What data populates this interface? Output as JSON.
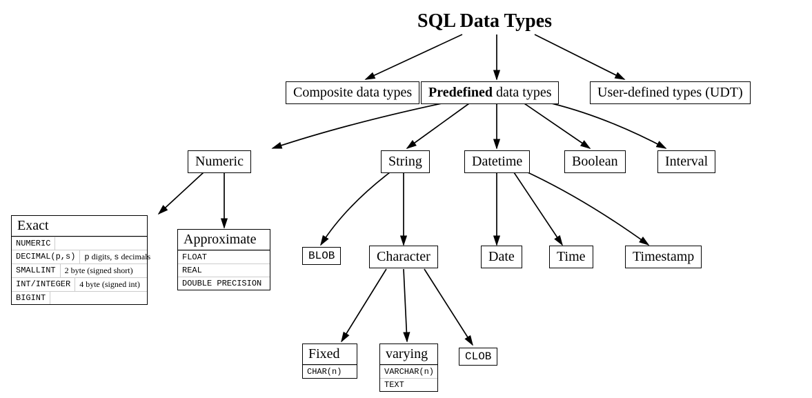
{
  "title": "SQL Data Types",
  "level1": {
    "composite": "Composite data types",
    "predefined_bold": "Predefined",
    "predefined_rest": " data types",
    "udt": "User-defined types (UDT)"
  },
  "predefined_children": {
    "numeric": "Numeric",
    "string": "String",
    "datetime": "Datetime",
    "boolean": "Boolean",
    "interval": "Interval"
  },
  "numeric": {
    "exact": {
      "header": "Exact",
      "rows": [
        {
          "type": "NUMERIC",
          "desc": ""
        },
        {
          "type": "DECIMAL(p,s)",
          "desc": "p digits, s decimals"
        },
        {
          "type": "SMALLINT",
          "desc": "2 byte (signed short)"
        },
        {
          "type": "INT/INTEGER",
          "desc": "4 byte (signed int)"
        },
        {
          "type": "BIGINT",
          "desc": ""
        }
      ]
    },
    "approximate": {
      "header": "Approximate",
      "rows": [
        {
          "type": "FLOAT"
        },
        {
          "type": "REAL"
        },
        {
          "type": "DOUBLE PRECISION"
        }
      ]
    }
  },
  "string": {
    "blob": "BLOB",
    "character": "Character",
    "fixed": {
      "header": "Fixed",
      "rows": [
        {
          "type": "CHAR(n)"
        }
      ]
    },
    "varying": {
      "header": "varying",
      "rows": [
        {
          "type": "VARCHAR(n)"
        },
        {
          "type": "TEXT"
        }
      ]
    },
    "clob": "CLOB"
  },
  "datetime": {
    "date": "Date",
    "time": "Time",
    "timestamp": "Timestamp"
  },
  "chart_data": {
    "type": "tree",
    "root": "SQL Data Types",
    "children": [
      {
        "name": "Composite data types"
      },
      {
        "name": "Predefined data types",
        "children": [
          {
            "name": "Numeric",
            "children": [
              {
                "name": "Exact",
                "types": [
                  "NUMERIC",
                  "DECIMAL(p,s)",
                  "SMALLINT",
                  "INT/INTEGER",
                  "BIGINT"
                ],
                "notes": {
                  "DECIMAL(p,s)": "p digits, s decimals",
                  "SMALLINT": "2 byte (signed short)",
                  "INT/INTEGER": "4 byte (signed int)"
                }
              },
              {
                "name": "Approximate",
                "types": [
                  "FLOAT",
                  "REAL",
                  "DOUBLE PRECISION"
                ]
              }
            ]
          },
          {
            "name": "String",
            "children": [
              {
                "name": "BLOB"
              },
              {
                "name": "Character",
                "children": [
                  {
                    "name": "Fixed",
                    "types": [
                      "CHAR(n)"
                    ]
                  },
                  {
                    "name": "varying",
                    "types": [
                      "VARCHAR(n)",
                      "TEXT"
                    ]
                  },
                  {
                    "name": "CLOB"
                  }
                ]
              }
            ]
          },
          {
            "name": "Datetime",
            "children": [
              {
                "name": "Date"
              },
              {
                "name": "Time"
              },
              {
                "name": "Timestamp"
              }
            ]
          },
          {
            "name": "Boolean"
          },
          {
            "name": "Interval"
          }
        ]
      },
      {
        "name": "User-defined types (UDT)"
      }
    ]
  }
}
